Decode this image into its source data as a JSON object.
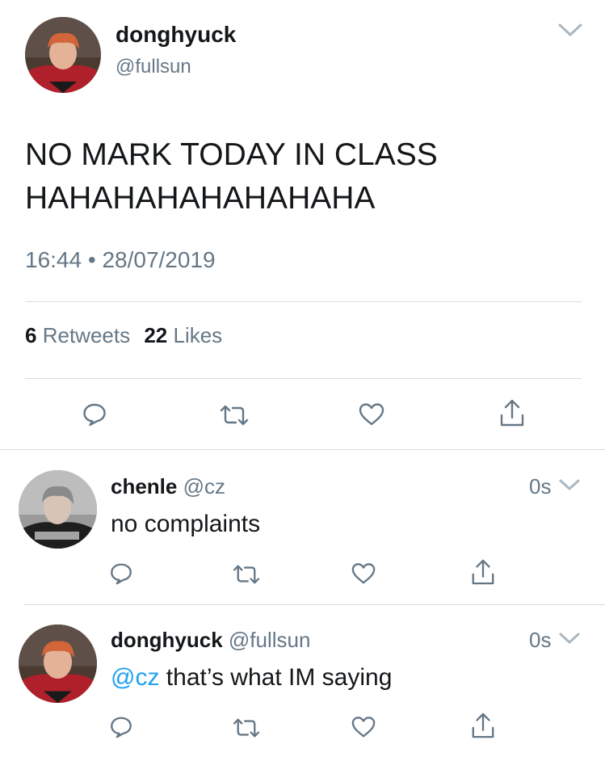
{
  "main_tweet": {
    "display_name": "donghyuck",
    "handle": "@fullsun",
    "text_line1": "NO MARK TODAY IN CLASS",
    "text_line2": "HAHAHAHAHAHAHAHA",
    "time": "16:44",
    "separator": "•",
    "date": "28/07/2019",
    "retweet_count": "6",
    "retweet_label": "Retweets",
    "like_count": "22",
    "like_label": "Likes"
  },
  "replies": [
    {
      "display_name": "chenle",
      "handle": "@cz",
      "time": "0s",
      "text": "no complaints"
    },
    {
      "display_name": "donghyuck",
      "handle": "@fullsun",
      "time": "0s",
      "mention": "@cz",
      "text": " that’s what IM saying"
    }
  ],
  "icons": {
    "reply": "reply-icon",
    "retweet": "retweet-icon",
    "like": "heart-icon",
    "share": "share-icon",
    "menu": "chevron-down-icon"
  },
  "colors": {
    "text": "#14171a",
    "secondary": "#657786",
    "link": "#1da1f2",
    "divider": "#d7dbdf"
  }
}
